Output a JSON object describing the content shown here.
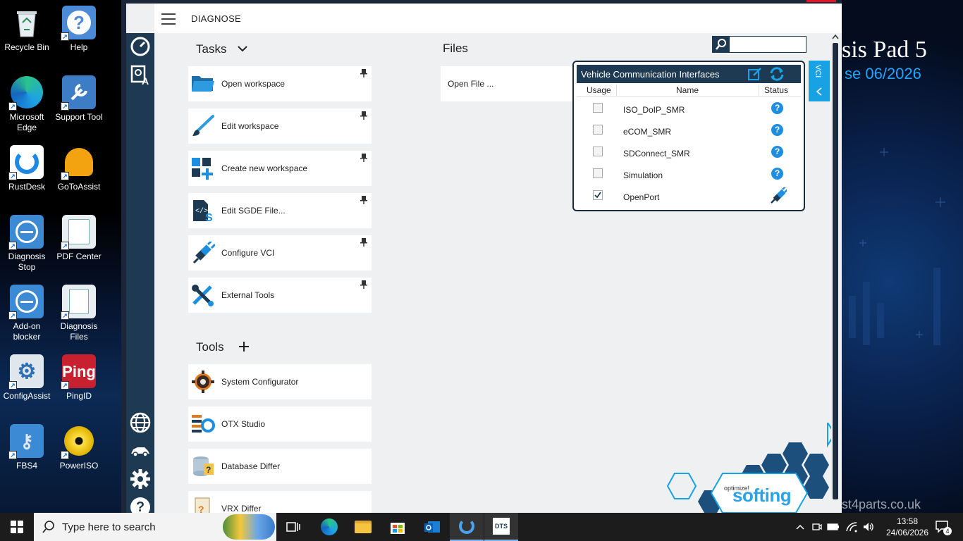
{
  "wallpaper": {
    "title": "sis Pad 5",
    "subtitle": "se 06/2026",
    "url": "st4parts.co.uk"
  },
  "desktop_icons": [
    {
      "label": "Recycle Bin",
      "icon": "recycle-bin-icon"
    },
    {
      "label": "Help",
      "icon": "help-icon"
    },
    {
      "label": "Microsoft Edge",
      "icon": "edge-icon"
    },
    {
      "label": "Support Tool",
      "icon": "support-tool-icon"
    },
    {
      "label": "RustDesk",
      "icon": "rustdesk-icon"
    },
    {
      "label": "GoToAssist",
      "icon": "gotoassist-icon"
    },
    {
      "label": "Diagnosis Stop",
      "icon": "diagnosis-stop-icon"
    },
    {
      "label": "PDF Center",
      "icon": "pdf-center-icon"
    },
    {
      "label": "Add-on blocker",
      "icon": "addon-blocker-icon"
    },
    {
      "label": "Diagnosis Files",
      "icon": "diagnosis-files-icon"
    },
    {
      "label": "ConfigAssist",
      "icon": "configassist-icon"
    },
    {
      "label": "PingID",
      "icon": "pingid-icon",
      "logo_text": "Ping"
    },
    {
      "label": "FBS4",
      "icon": "fbs4-icon"
    },
    {
      "label": "PowerISO",
      "icon": "poweriso-icon"
    }
  ],
  "app": {
    "title": "DIAGNOSE",
    "tasks_title": "Tasks",
    "tasks": [
      {
        "label": "Open workspace",
        "icon": "folder-icon"
      },
      {
        "label": "Edit workspace",
        "icon": "brush-icon"
      },
      {
        "label": "Create new workspace",
        "icon": "add-workspace-icon"
      },
      {
        "label": "Edit SGDE File...",
        "icon": "sgde-file-icon"
      },
      {
        "label": "Configure VCI",
        "icon": "plug-icon"
      },
      {
        "label": "External Tools",
        "icon": "tools-icon"
      }
    ],
    "tools_title": "Tools",
    "tools": [
      {
        "label": "System Configurator",
        "icon": "gear-icon"
      },
      {
        "label": "OTX Studio",
        "icon": "otx-studio-icon"
      },
      {
        "label": "Database Differ",
        "icon": "database-differ-icon"
      },
      {
        "label": "VRX Differ",
        "icon": "vrx-differ-icon"
      }
    ],
    "files_title": "Files",
    "files_open": "Open File ...",
    "search_value": "",
    "vci_tab": "VCI",
    "brand_tagline": "optimize!",
    "brand": "softing"
  },
  "vci": {
    "title": "Vehicle Communication Interfaces",
    "columns": [
      "Usage",
      "Name",
      "Status"
    ],
    "rows": [
      {
        "name": "ISO_DoIP_SMR",
        "checked": false,
        "status": "?"
      },
      {
        "name": "eCOM_SMR",
        "checked": false,
        "status": "?"
      },
      {
        "name": "SDConnect_SMR",
        "checked": false,
        "status": "?"
      },
      {
        "name": "Simulation",
        "checked": false,
        "status": "?"
      },
      {
        "name": "OpenPort",
        "checked": true,
        "status": "connected-plug-icon"
      }
    ]
  },
  "taskbar": {
    "search_placeholder": "Type here to search",
    "time": "13:58",
    "date": "24/06/2026",
    "notifications": "4"
  }
}
